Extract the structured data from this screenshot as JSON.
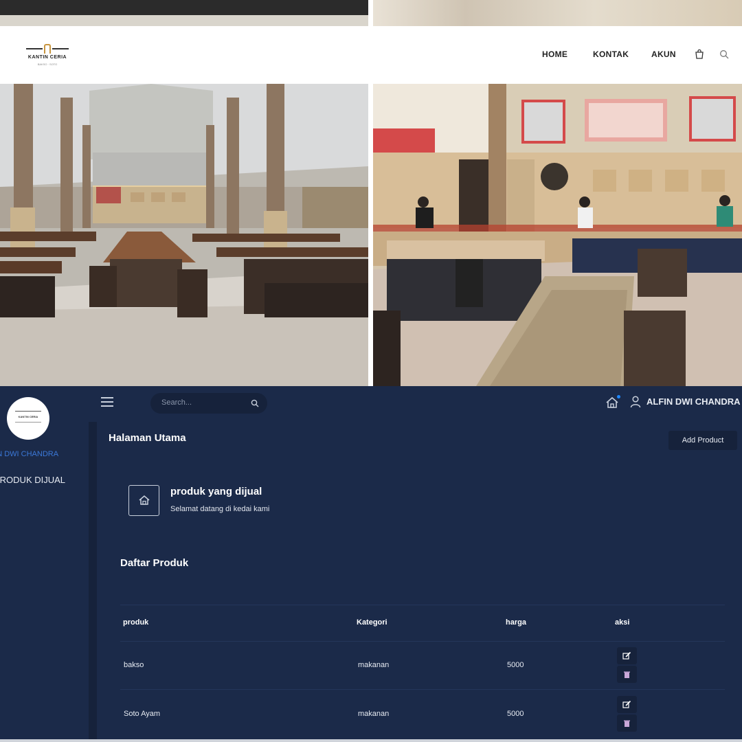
{
  "site": {
    "brand": "KANTIN CERIA",
    "tagline": "BAKSO · SOTO",
    "nav": [
      "HOME",
      "KONTAK",
      "AKUN"
    ]
  },
  "dashboard": {
    "user_name": "ALFIN DWI CHANDRA",
    "sidebar": {
      "user_label": "ALFIN DWI CHANDRA",
      "menu_item": "PRODUK DIJUAL"
    },
    "search": {
      "placeholder": "Search..."
    },
    "page_title": "Halaman Utama",
    "add_button": "Add Product",
    "card": {
      "title": "produk yang dijual",
      "subtitle": "Selamat datang di kedai kami"
    },
    "list_title": "Daftar Produk",
    "table": {
      "headers": [
        "produk",
        "Kategori",
        "harga",
        "aksi"
      ],
      "rows": [
        {
          "produk": "bakso",
          "kategori": "makanan",
          "harga": "5000"
        },
        {
          "produk": "Soto Ayam",
          "kategori": "makanan",
          "harga": "5000"
        }
      ]
    }
  },
  "colors": {
    "dashboard_bg": "#1b2a49",
    "panel_dark": "#16223b",
    "accent_blue": "#3b78d8",
    "logo_gold": "#c8953f"
  }
}
